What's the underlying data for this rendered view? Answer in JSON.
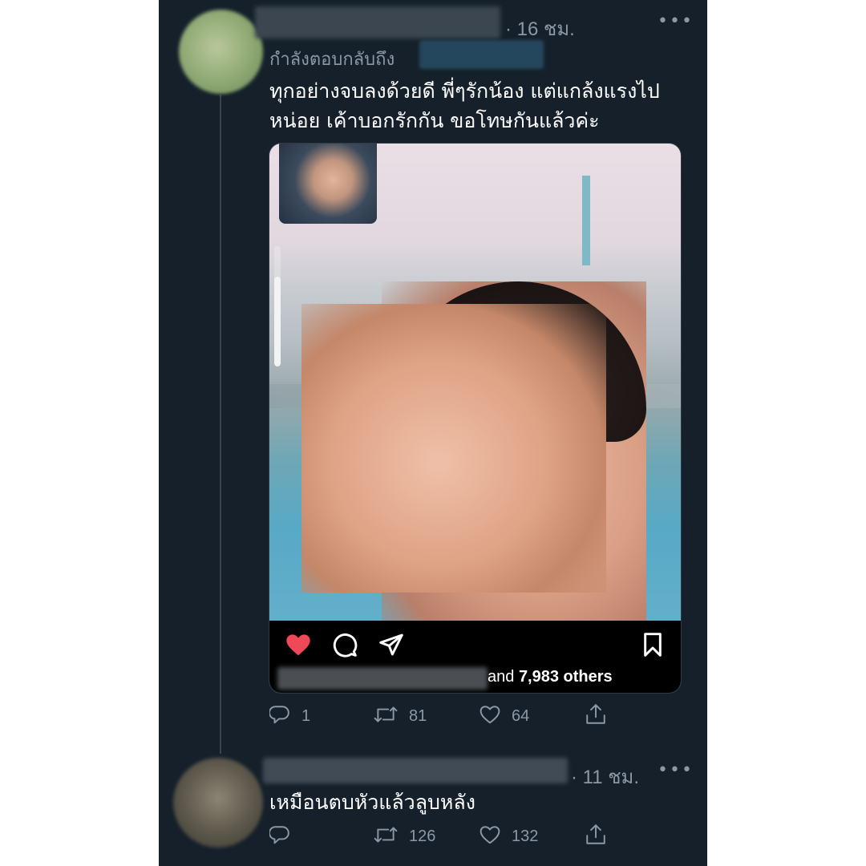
{
  "tweet1": {
    "time": "· 16 ชม.",
    "more": "•••",
    "replying_label": "กำลังตอบกลับถึง",
    "text_line1": "ทุกอย่างจบลงด้วยดี พี่ๆรักน้อง แต่แกล้งแรงไป",
    "text_line2": "หน่อย เค้าบอกรักกัน ขอโทษกันแล้วค่ะ",
    "media": {
      "story_progress": 0.75,
      "instagram_bar": {
        "icons": [
          "heart-icon",
          "comment-icon",
          "share-icon",
          "bookmark-icon"
        ],
        "likes_and": "and",
        "likes_count": "7,983 others",
        "heart_color": "#ed4956"
      }
    },
    "actions": {
      "reply": "1",
      "retweet": "81",
      "like": "64"
    }
  },
  "tweet2": {
    "time": "· 11 ชม.",
    "more": "•••",
    "text": "เหมือนตบหัวแล้วลูบหลัง",
    "actions": {
      "reply": "",
      "retweet": "126",
      "like": "132"
    }
  },
  "colors": {
    "background": "#15202b",
    "secondary_text": "#8b98a5",
    "thread_line": "#38444d"
  }
}
